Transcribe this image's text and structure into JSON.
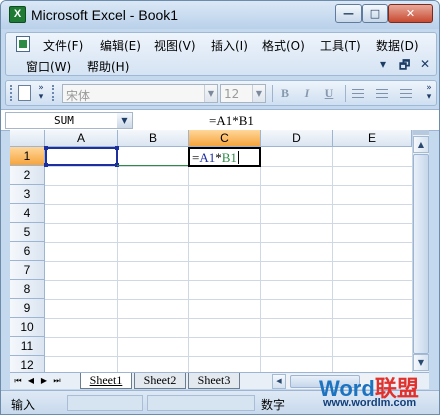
{
  "window": {
    "title": "Microsoft Excel - Book1",
    "min_glyph": "—",
    "max_glyph": "□",
    "close_glyph": "✕"
  },
  "menubar": {
    "items": [
      {
        "label": "文件(F)"
      },
      {
        "label": "编辑(E)"
      },
      {
        "label": "视图(V)"
      },
      {
        "label": "插入(I)"
      },
      {
        "label": "格式(O)"
      },
      {
        "label": "工具(T)"
      },
      {
        "label": "数据(D)"
      },
      {
        "label": "窗口(W)"
      },
      {
        "label": "帮助(H)"
      }
    ],
    "window_controls": {
      "min": "▾",
      "restore": "🗗",
      "close": "✕"
    }
  },
  "toolbar": {
    "font_name": "宋体",
    "font_size": "12",
    "bold": "B",
    "italic": "I",
    "underline": "U",
    "icons": [
      "new-document-icon",
      "toolbar-options-icon",
      "align-left-icon",
      "align-center-icon",
      "align-right-icon"
    ]
  },
  "formula_bar": {
    "name_box": "SUM",
    "formula": "=A1*B1"
  },
  "grid": {
    "columns": [
      "A",
      "B",
      "C",
      "D",
      "E"
    ],
    "rows": [
      "1",
      "2",
      "3",
      "4",
      "5",
      "6",
      "7",
      "8",
      "9",
      "10",
      "11",
      "12"
    ],
    "active_cell": "C1",
    "active_cell_content": {
      "prefix": "=",
      "ref1": "A1",
      "op": "*",
      "ref2": "B1"
    },
    "ref_colors": {
      "A1": "#1d2e9e",
      "B1": "#2e8b45"
    },
    "active_header_color": "#f6a43e"
  },
  "sheets": {
    "tabs": [
      "Sheet1",
      "Sheet2",
      "Sheet3"
    ],
    "active": "Sheet1",
    "nav": [
      "⏮",
      "◀",
      "▶",
      "⏭"
    ]
  },
  "statusbar": {
    "mode": "输入",
    "num_indicator": "数字"
  },
  "watermark": {
    "logo_part1": "Word",
    "logo_part2": "联盟",
    "url": "www.wordlm.com"
  }
}
